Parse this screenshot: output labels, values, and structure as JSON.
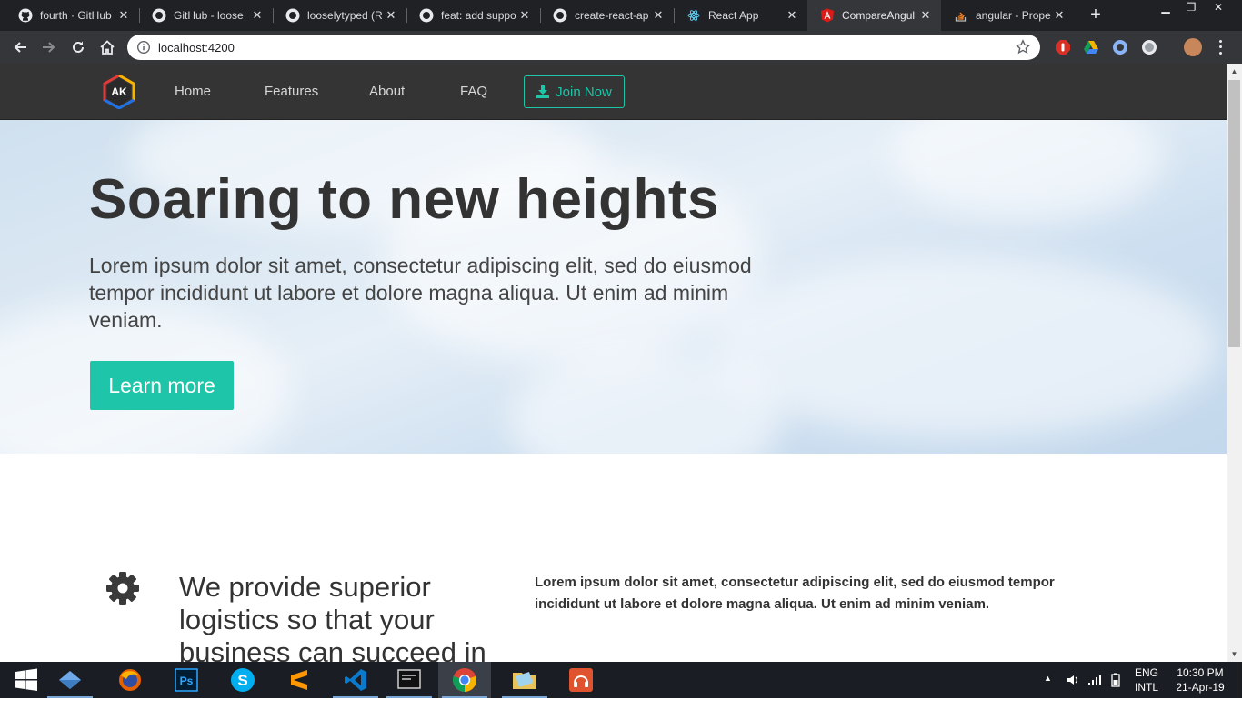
{
  "browser": {
    "tabs": [
      {
        "title": "fourth · GitHub",
        "icon": "github-icon"
      },
      {
        "title": "GitHub - loose",
        "icon": "github-icon"
      },
      {
        "title": "looselytyped (R",
        "icon": "github-icon"
      },
      {
        "title": "feat: add suppo",
        "icon": "github-icon"
      },
      {
        "title": "create-react-ap",
        "icon": "github-icon"
      },
      {
        "title": "React App",
        "icon": "react-icon"
      },
      {
        "title": "CompareAngul",
        "icon": "angular-icon"
      },
      {
        "title": "angular - Prope",
        "icon": "stackoverflow-icon"
      }
    ],
    "active_tab": 6,
    "url": "localhost:4200"
  },
  "site": {
    "logo_text": "AK",
    "nav": [
      "Home",
      "Features",
      "About",
      "FAQ"
    ],
    "join_label": "Join Now",
    "hero": {
      "title": "Soaring to new heights",
      "text": "Lorem ipsum dolor sit amet, consectetur adipiscing elit, sed do eiusmod tempor incididunt ut labore et dolore magna aliqua. Ut enim ad minim veniam.",
      "cta": "Learn more"
    },
    "feature": {
      "heading": "We provide superior logistics so that your business can succeed in",
      "text": "Lorem ipsum dolor sit amet, consectetur adipiscing elit, sed do eiusmod tempor incididunt ut labore et dolore magna aliqua. Ut enim ad minim veniam."
    }
  },
  "taskbar": {
    "apps": [
      "file-explorer-icon",
      "firefox-icon",
      "photoshop-icon",
      "skype-icon",
      "sublime-text-icon",
      "vscode-icon",
      "console-icon",
      "chrome-icon",
      "folder-icon",
      "music-player-icon"
    ],
    "lang_top": "ENG",
    "lang_bottom": "INTL",
    "time": "10:30 PM",
    "date": "21-Apr-19"
  },
  "colors": {
    "accent": "#1ec5a9",
    "navbar": "#343434",
    "chrome_dark": "#202124"
  }
}
